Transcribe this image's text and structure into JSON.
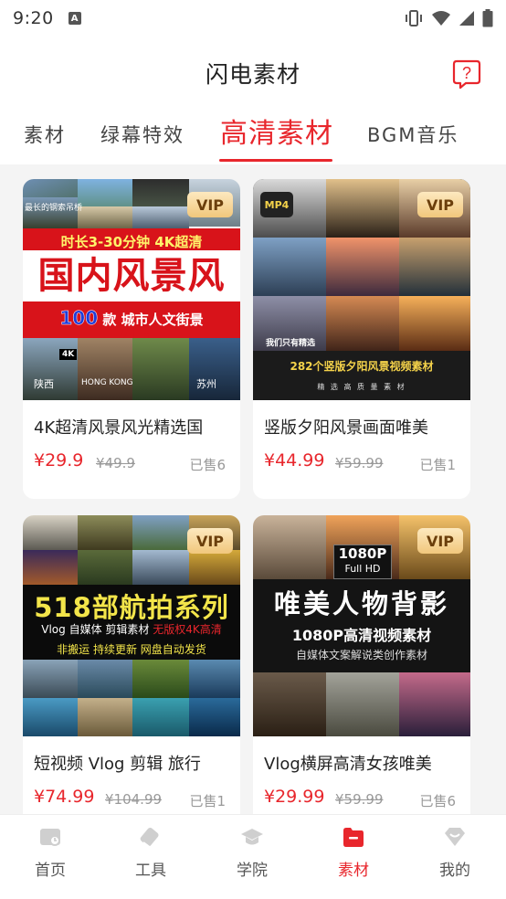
{
  "status": {
    "time": "9:20"
  },
  "header": {
    "title": "闪电素材"
  },
  "tabs": [
    {
      "label": "素材"
    },
    {
      "label": "绿幕特效"
    },
    {
      "label": "高清素材"
    },
    {
      "label": "BGM音乐"
    }
  ],
  "cards": [
    {
      "title": "4K超清风景风光精选国",
      "price": "¥29.9",
      "original_price": "¥49.9",
      "sold": "已售6",
      "badge": "VIP",
      "thumb": {
        "top_small": "最长的钢索吊桥",
        "line1": "时长3-30分钟 4K超清",
        "headline": "国内风景风光",
        "line3_num": "100",
        "line3_rest": "款 城市人文街景",
        "tag4k": "4K",
        "city1": "陕西",
        "city2": "HONG KONG",
        "city3": "苏州"
      }
    },
    {
      "title": "竖版夕阳风景画面唯美",
      "price": "¥44.99",
      "original_price": "¥59.99",
      "sold": "已售1",
      "badge": "VIP",
      "format": "MP4",
      "thumb": {
        "small": "我们只有精选",
        "headline": "282个竖版夕阳风景视频素材",
        "sub": "精 选 高 质 量 素 材"
      }
    },
    {
      "title": "短视频 Vlog 剪辑 旅行",
      "price": "¥74.99",
      "original_price": "¥104.99",
      "sold": "已售1",
      "badge": "VIP",
      "thumb": {
        "headline": "518部航拍系列",
        "line2a": "Vlog 自媒体 剪辑素材 ",
        "line2b": "无版权4K高清",
        "line3": "非搬运 持续更新 网盘自动发货"
      }
    },
    {
      "title": "Vlog横屏高清女孩唯美",
      "price": "¥29.99",
      "original_price": "¥59.99",
      "sold": "已售6",
      "badge": "VIP",
      "thumb": {
        "res1": "1080P",
        "res2": "Full HD",
        "headline": "唯美人物背影",
        "line2": "1080P高清视频素材",
        "line3": "自媒体文案解说类创作素材"
      }
    }
  ],
  "bottom_nav": [
    {
      "label": "首页",
      "icon": "home-icon"
    },
    {
      "label": "工具",
      "icon": "tool-icon"
    },
    {
      "label": "学院",
      "icon": "academy-icon"
    },
    {
      "label": "素材",
      "icon": "material-icon",
      "active": true
    },
    {
      "label": "我的",
      "icon": "profile-icon"
    }
  ],
  "colors": {
    "accent": "#e8262c",
    "vip_gold": "#f1c77c"
  }
}
